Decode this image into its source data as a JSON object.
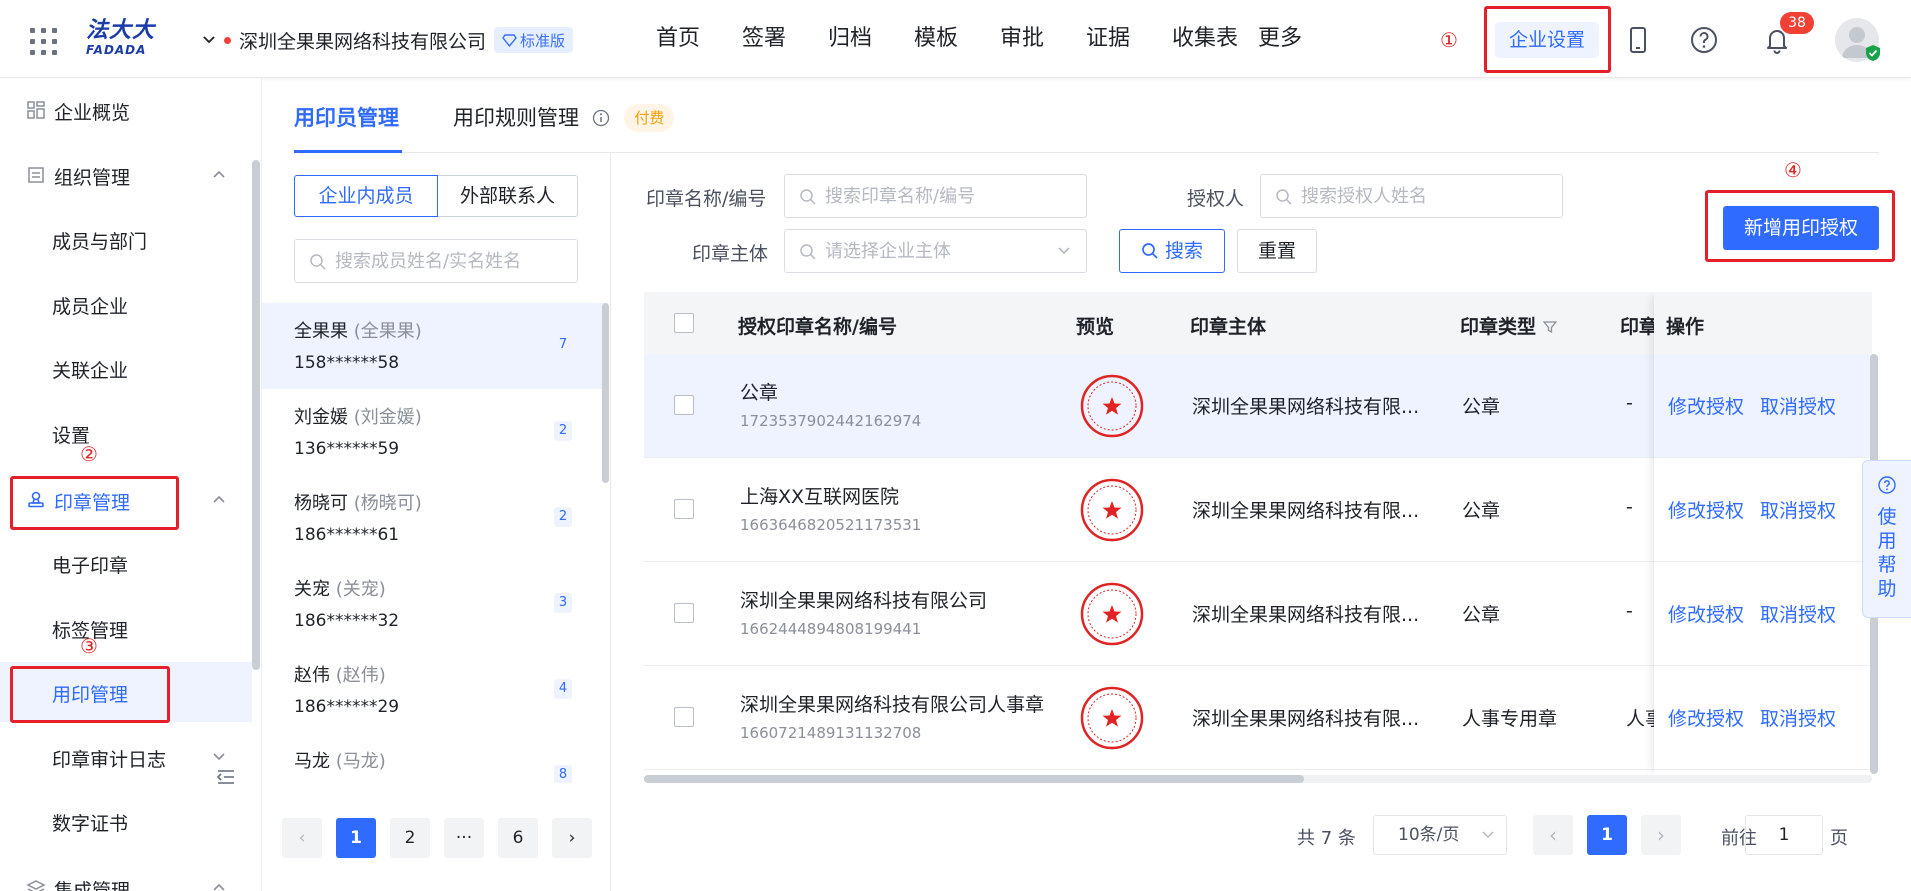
{
  "header": {
    "logo_cn": "法大大",
    "logo_en": "FADADA",
    "company_name": "深圳全果果网络科技有限公司",
    "edition": "标准版",
    "nav": [
      "首页",
      "签署",
      "归档",
      "模板",
      "审批",
      "证据",
      "收集表",
      "更多"
    ],
    "enterprise_settings": "企业设置",
    "notification_count": "38"
  },
  "markers": {
    "m1": "①",
    "m2": "②",
    "m3": "③",
    "m4": "④"
  },
  "sidebar": {
    "items": [
      {
        "label": "企业概览"
      },
      {
        "label": "组织管理"
      },
      {
        "label": "成员与部门"
      },
      {
        "label": "成员企业"
      },
      {
        "label": "关联企业"
      },
      {
        "label": "设置"
      },
      {
        "label": "印章管理"
      },
      {
        "label": "电子印章"
      },
      {
        "label": "标签管理"
      },
      {
        "label": "用印管理"
      },
      {
        "label": "印章审计日志"
      },
      {
        "label": "数字证书"
      },
      {
        "label": "集成管理"
      }
    ]
  },
  "tabs": {
    "user_mgmt": "用印员管理",
    "rule_mgmt": "用印规则管理",
    "paid": "付费"
  },
  "members": {
    "seg_internal": "企业内成员",
    "seg_external": "外部联系人",
    "search_placeholder": "搜索成员姓名/实名姓名",
    "list": [
      {
        "name": "全果果",
        "real": "(全果果)",
        "phone": "158******58",
        "count": "7"
      },
      {
        "name": "刘金媛",
        "real": "(刘金媛)",
        "phone": "136******59",
        "count": "2"
      },
      {
        "name": "杨晓可",
        "real": "(杨晓可)",
        "phone": "186******61",
        "count": "2"
      },
      {
        "name": "关宠",
        "real": "(关宠)",
        "phone": "186******32",
        "count": "3"
      },
      {
        "name": "赵伟",
        "real": "(赵伟)",
        "phone": "186******29",
        "count": "4"
      },
      {
        "name": "马龙",
        "real": "(马龙)",
        "phone": "",
        "count": "8"
      }
    ],
    "pager": {
      "prev": "‹",
      "p1": "1",
      "p2": "2",
      "ellipsis": "···",
      "p6": "6",
      "next": "›"
    }
  },
  "filters": {
    "seal_label": "印章名称/编号",
    "seal_placeholder": "搜索印章名称/编号",
    "grantee_label": "授权人",
    "grantee_placeholder": "搜索授权人姓名",
    "entity_label": "印章主体",
    "entity_placeholder": "请选择企业主体",
    "search_btn": "搜索",
    "reset_btn": "重置",
    "add_btn": "新增用印授权"
  },
  "table": {
    "headers": {
      "name": "授权印章名称/编号",
      "preview": "预览",
      "entity": "印章主体",
      "type": "印章类型",
      "extra": "印章",
      "ops": "操作"
    },
    "rows": [
      {
        "name": "公章",
        "id": "1723537902442162974",
        "entity": "深圳全果果网络科技有限...",
        "type": "公章",
        "extra": "-",
        "edit": "修改授权",
        "cancel": "取消授权"
      },
      {
        "name": "上海XX互联网医院",
        "id": "1663646820521173531",
        "entity": "深圳全果果网络科技有限...",
        "type": "公章",
        "extra": "-",
        "edit": "修改授权",
        "cancel": "取消授权"
      },
      {
        "name": "深圳全果果网络科技有限公司",
        "id": "1662444894808199441",
        "entity": "深圳全果果网络科技有限...",
        "type": "公章",
        "extra": "-",
        "edit": "修改授权",
        "cancel": "取消授权"
      },
      {
        "name": "深圳全果果网络科技有限公司人事章",
        "id": "1660721489131132708",
        "entity": "深圳全果果网络科技有限...",
        "type": "人事专用章",
        "extra": "人事",
        "edit": "修改授权",
        "cancel": "取消授权"
      }
    ]
  },
  "pagination": {
    "total": "共 7 条",
    "page_size": "10条/页",
    "prev": "‹",
    "current": "1",
    "next": "›",
    "goto_prefix": "前往",
    "goto_value": "1",
    "goto_suffix": "页"
  },
  "help": {
    "label": "使用帮助"
  },
  "colors": {
    "primary": "#2f6bff",
    "annotation_red": "#e5202a",
    "seal_red": "#e02424"
  }
}
